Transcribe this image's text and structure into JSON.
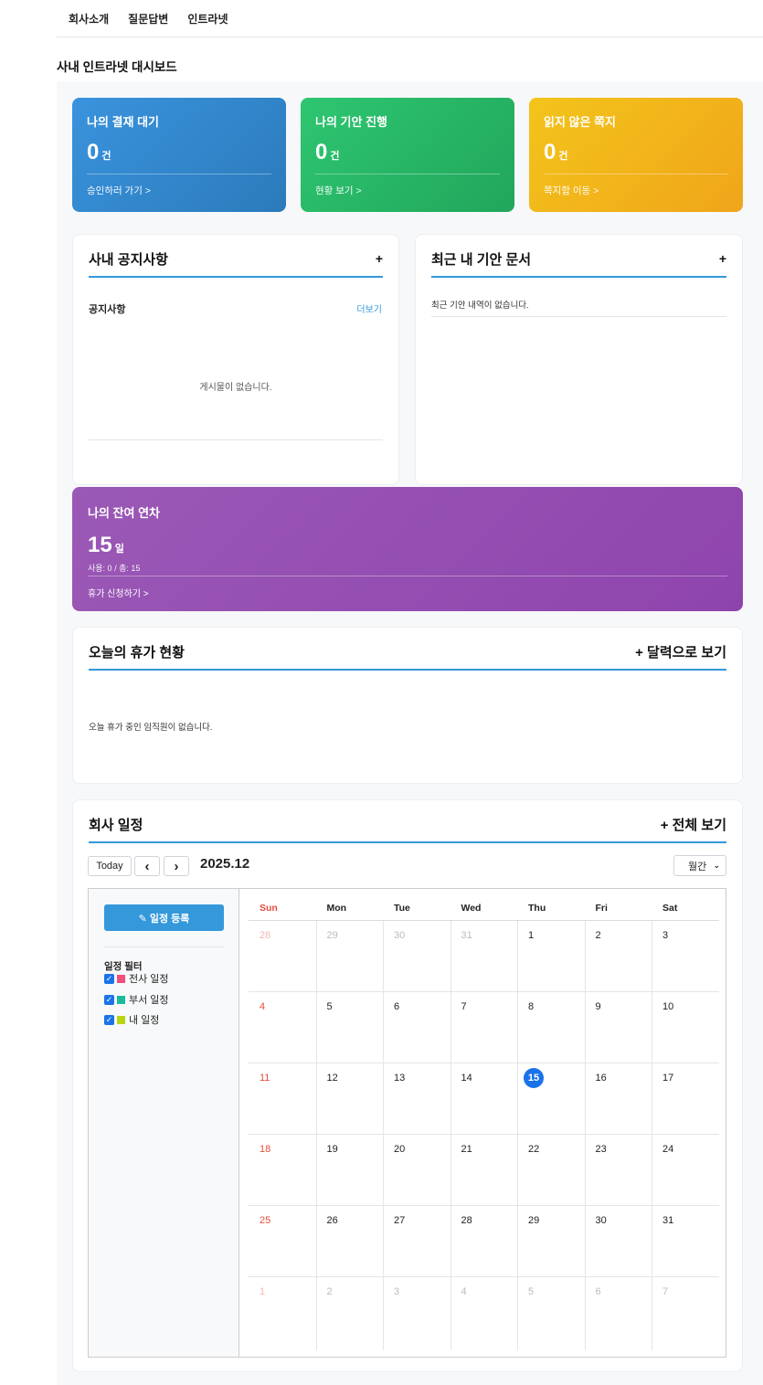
{
  "nav": [
    "회사소개",
    "질문답변",
    "인트라넷"
  ],
  "page_title": "사내 인트라넷 대시보드",
  "stats": [
    {
      "title": "나의 결재 대기",
      "value": "0",
      "unit": "건",
      "link": "승인하러 가기 >"
    },
    {
      "title": "나의 기안 진행",
      "value": "0",
      "unit": "건",
      "link": "현황 보기 >"
    },
    {
      "title": "읽지 않은 쪽지",
      "value": "0",
      "unit": "건",
      "link": "쪽지함 이동 >"
    }
  ],
  "notice": {
    "title": "사내 공지사항",
    "plus": "+",
    "sub": "공지사항",
    "more": "더보기",
    "empty": "게시물이 없습니다."
  },
  "drafts": {
    "title": "최근 내 기안 문서",
    "plus": "+",
    "empty": "최근 기안 내역이 없습니다."
  },
  "vacation": {
    "title": "나의 잔여 연차",
    "value": "15",
    "unit": "일",
    "usage": "사용: 0 / 총: 15",
    "link": "휴가 신청하기 >"
  },
  "today_vac": {
    "title": "오늘의 휴가 현황",
    "action": "+ 달력으로 보기",
    "empty": "오늘 휴가 중인 임직원이 없습니다."
  },
  "schedule": {
    "title": "회사 일정",
    "action": "+ 전체 보기",
    "today_btn": "Today",
    "prev": "‹",
    "next": "›",
    "month_label": "2025.12",
    "view_select": "월간",
    "register_btn": "✎ 일정 등록",
    "filter_title": "일정 필터",
    "filters": [
      {
        "label": "전사 일정",
        "color": "#f0507a"
      },
      {
        "label": "부서 일정",
        "color": "#1abc9c"
      },
      {
        "label": "내 일정",
        "color": "#b5d611"
      }
    ],
    "weekdays": [
      "Sun",
      "Mon",
      "Tue",
      "Wed",
      "Thu",
      "Fri",
      "Sat"
    ],
    "weeks": [
      [
        "28",
        "29",
        "30",
        "31",
        "1",
        "2",
        "3"
      ],
      [
        "4",
        "5",
        "6",
        "7",
        "8",
        "9",
        "10"
      ],
      [
        "11",
        "12",
        "13",
        "14",
        "15",
        "16",
        "17"
      ],
      [
        "18",
        "19",
        "20",
        "21",
        "22",
        "23",
        "24"
      ],
      [
        "25",
        "26",
        "27",
        "28",
        "29",
        "30",
        "31"
      ],
      [
        "1",
        "2",
        "3",
        "4",
        "5",
        "6",
        "7"
      ]
    ],
    "today": "15"
  }
}
